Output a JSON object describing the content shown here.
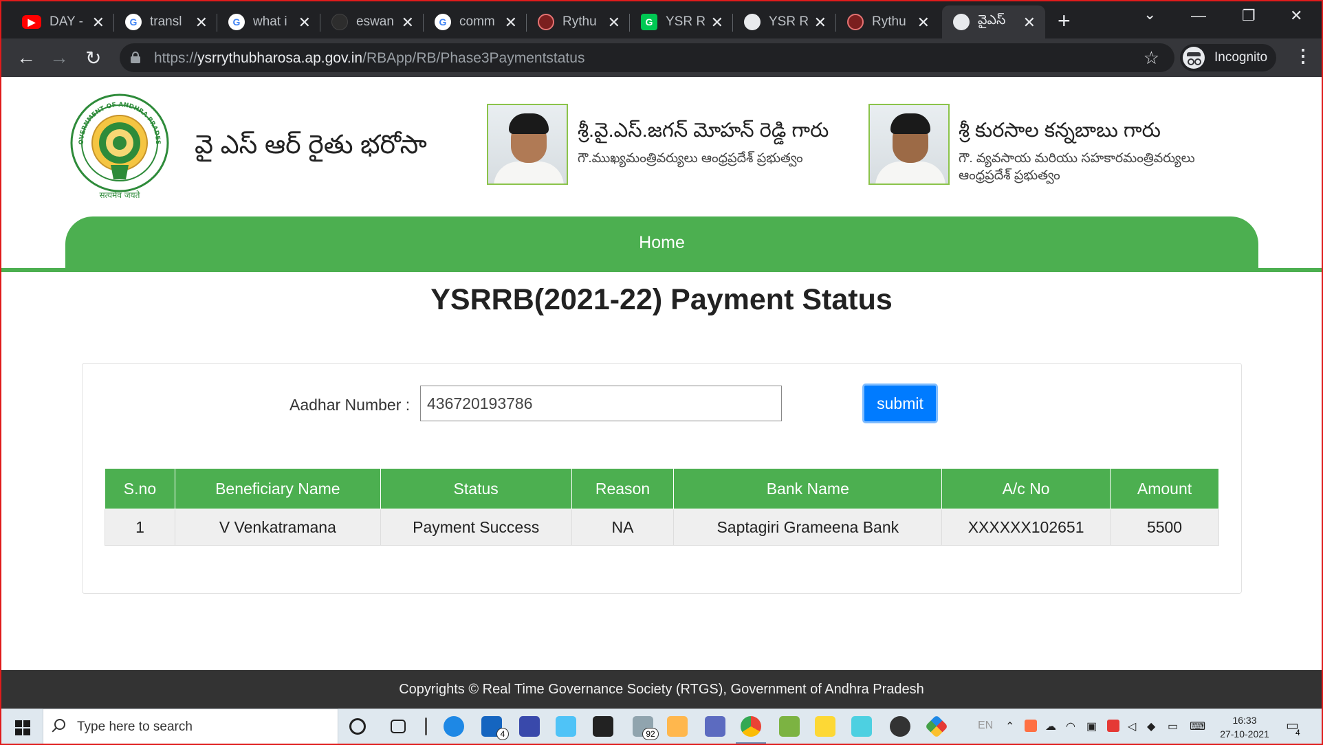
{
  "browser": {
    "tabs": [
      {
        "title": "DAY -",
        "icon": "youtube-icon",
        "color": "#ff0000"
      },
      {
        "title": "transl",
        "icon": "google-icon",
        "color": "#4285f4"
      },
      {
        "title": "what i",
        "icon": "google-icon",
        "color": "#4285f4"
      },
      {
        "title": "eswan",
        "icon": "github-icon",
        "color": "#24292e"
      },
      {
        "title": "comm",
        "icon": "google-icon",
        "color": "#4285f4"
      },
      {
        "title": "Rythu",
        "icon": "rythu-icon",
        "color": "#c62828"
      },
      {
        "title": "YSR R",
        "icon": "green-g-icon",
        "color": "#00c853"
      },
      {
        "title": "YSR R",
        "icon": "globe-icon",
        "color": "#9aa0a6"
      },
      {
        "title": "Rythu",
        "icon": "rythu-icon",
        "color": "#c62828"
      },
      {
        "title": "వైఎస్",
        "icon": "globe-icon",
        "color": "#9aa0a6",
        "active": true
      }
    ],
    "close_glyph": "✕",
    "new_tab": "+",
    "url_scheme": "https://",
    "url_host": "ysrrythubharosa.ap.gov.in",
    "url_path": "/RBApp/RB/Phase3Paymentstatus",
    "incognito_label": "Incognito"
  },
  "header": {
    "site_title": "వై ఎస్ ఆర్ రైతు భరోసా",
    "emblem_text": "GOVERNMENT OF ANDHRA PRADESH",
    "emblem_motto": "सत्यमेव जयते",
    "leaders": [
      {
        "name": "శ్రీ.వై.ఎస్.జగన్ మోహన్ రెడ్డి గారు",
        "designation": "గౌ.ముఖ్యమంత్రివర్యులు ఆంధ్రప్రదేశ్ ప్రభుత్వం"
      },
      {
        "name": "శ్రీ కురసాల కన్నబాబు గారు",
        "designation": "గౌ. వ్యవసాయ మరియు సహకారమంత్రివర్యులు ఆంధ్రప్రదేశ్ ప్రభుత్వం"
      }
    ]
  },
  "nav": {
    "home": "Home"
  },
  "page": {
    "title": "YSRRB(2021-22) Payment Status",
    "form": {
      "aadhar_label": "Aadhar Number :",
      "aadhar_value": "436720193786",
      "submit_label": "submit"
    },
    "table": {
      "headers": [
        "S.no",
        "Beneficiary Name",
        "Status",
        "Reason",
        "Bank Name",
        "A/c No",
        "Amount"
      ],
      "rows": [
        [
          "1",
          "V Venkatramana",
          "Payment Success",
          "NA",
          "Saptagiri Grameena Bank",
          "XXXXXX102651",
          "5500"
        ]
      ]
    }
  },
  "footer": {
    "text": "Copyrights © Real Time Governance Society (RTGS), Government of Andhra Pradesh"
  },
  "taskbar": {
    "search_placeholder": "Type here to search",
    "mail_badge": "4",
    "files_badge": "92",
    "lang": "EN",
    "time": "16:33",
    "date": "27-10-2021",
    "notif_count": "4"
  },
  "colors": {
    "brand_green": "#4caf50",
    "submit_blue": "#007bff",
    "footer_dark": "#333333"
  }
}
